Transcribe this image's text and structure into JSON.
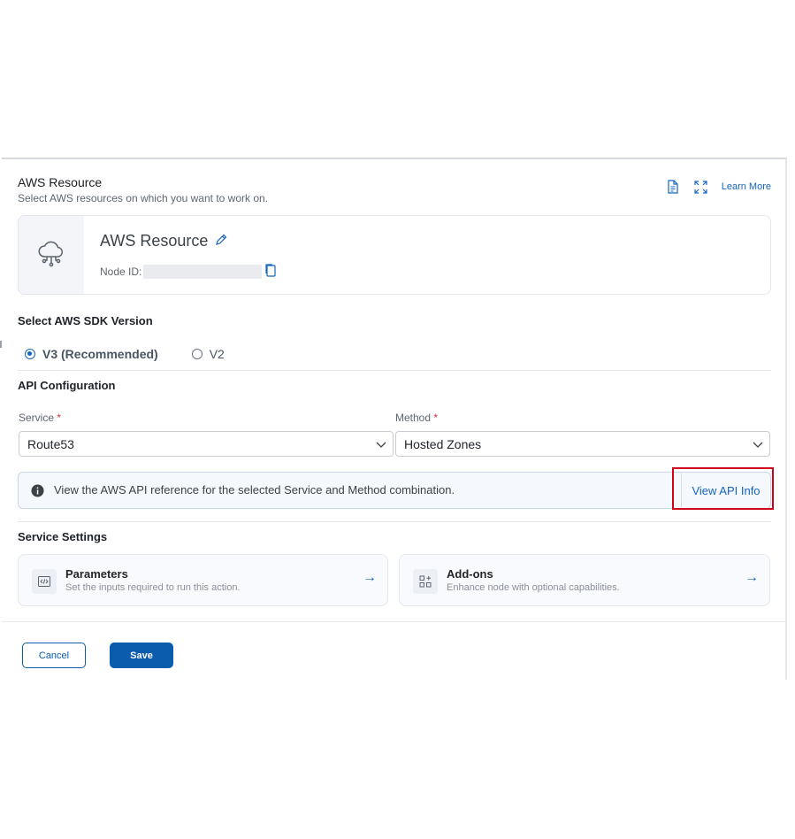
{
  "header": {
    "title": "AWS Resource",
    "subtitle": "Select AWS resources on which you want to work on.",
    "learn_more": "Learn More"
  },
  "node": {
    "name": "AWS Resource",
    "id_label": "Node ID:"
  },
  "sdk": {
    "label": "Select AWS SDK Version",
    "options": [
      {
        "label": "V3 (Recommended)",
        "selected": true
      },
      {
        "label": "V2",
        "selected": false
      }
    ]
  },
  "api_config": {
    "label": "API Configuration",
    "service_label": "Service",
    "service_value": "Route53",
    "method_label": "Method",
    "method_value": "Hosted Zones",
    "required_mark": "*"
  },
  "info": {
    "text": "View the AWS API reference for the selected Service and Method combination.",
    "button": "View API Info"
  },
  "service_settings": {
    "label": "Service Settings",
    "tiles": [
      {
        "title": "Parameters",
        "subtitle": "Set the inputs required to run this action.",
        "icon": "code-icon"
      },
      {
        "title": "Add-ons",
        "subtitle": "Enhance node with optional capabilities.",
        "icon": "add-ons-icon"
      }
    ]
  },
  "footer": {
    "cancel": "Cancel",
    "save": "Save"
  },
  "colors": {
    "accent": "#1565c0",
    "primary_button": "#0b5cad",
    "required": "#d32f2f",
    "highlight": "#d0021b"
  }
}
